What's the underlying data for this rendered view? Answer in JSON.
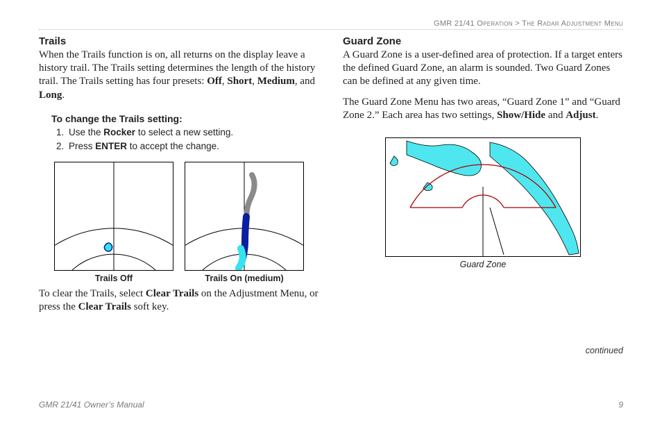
{
  "header": {
    "section": "GMR 21/41 Operation",
    "sep": ">",
    "subsection": "The Radar Adjustment Menu"
  },
  "left": {
    "title": "Trails",
    "intro_parts": {
      "p1": "When the Trails function is on, all returns on the display leave a history trail. The Trails setting determines the length of the history trail. The Trails setting has four presets: ",
      "off": "Off",
      "comma": ", ",
      "short": "Short",
      "medium": "Medium",
      "and": ", and ",
      "long": "Long",
      "dot": "."
    },
    "subheading": "To change the Trails setting:",
    "steps": {
      "s1a": "Use the ",
      "s1b": "Rocker",
      "s1c": " to select a new setting.",
      "s2a": "Press ",
      "s2b": "ENTER",
      "s2c": " to accept the change."
    },
    "captions": {
      "off": "Trails Off",
      "on": "Trails On (medium)"
    },
    "clear_parts": {
      "a": "To clear the Trails, select ",
      "b": "Clear Trails",
      "c": " on the Adjustment Menu, or press the ",
      "d": "Clear Trails",
      "e": " soft key."
    }
  },
  "right": {
    "title": "Guard Zone",
    "p1": "A Guard Zone is a user-defined area of protection. If a target enters the defined Guard Zone, an alarm is sounded. Two Guard Zones can be defined at any given time.",
    "p2_parts": {
      "a": "The Guard Zone Menu has two areas, “Guard Zone 1” and “Guard Zone 2.” Each area has two settings, ",
      "b": "Show/Hide",
      "c": " and ",
      "d": "Adjust",
      "e": "."
    },
    "caption": "Guard Zone",
    "continued": "continued"
  },
  "footer": {
    "left": "GMR 21/41 Owner’s Manual",
    "right": "9"
  }
}
